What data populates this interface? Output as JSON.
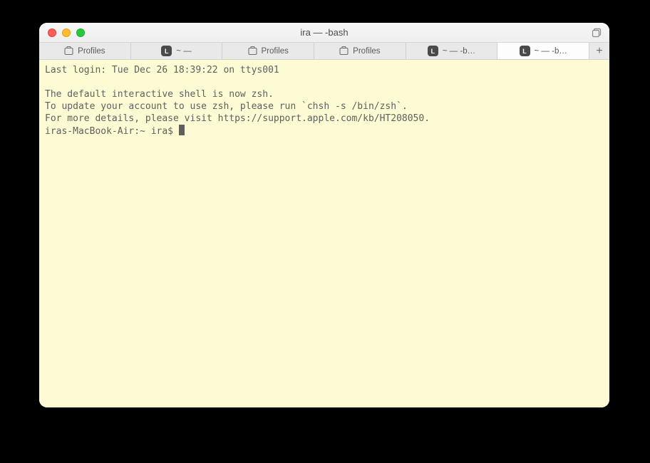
{
  "window": {
    "title": "ira — -bash"
  },
  "tabs": [
    {
      "kind": "profiles",
      "label": "Profiles",
      "active": false
    },
    {
      "kind": "shell",
      "label": "~ —",
      "badge": "L",
      "active": false
    },
    {
      "kind": "profiles",
      "label": "Profiles",
      "active": false
    },
    {
      "kind": "profiles",
      "label": "Profiles",
      "active": false
    },
    {
      "kind": "shell",
      "label": "~ — -b…",
      "badge": "L",
      "active": false
    },
    {
      "kind": "shell",
      "label": "~ — -b…",
      "badge": "L",
      "active": true
    }
  ],
  "newtab_label": "+",
  "terminal": {
    "line1": "Last login: Tue Dec 26 18:39:22 on ttys001",
    "blank": "",
    "line2": "The default interactive shell is now zsh.",
    "line3": "To update your account to use zsh, please run `chsh -s /bin/zsh`.",
    "line4": "For more details, please visit https://support.apple.com/kb/HT208050.",
    "prompt": "iras-MacBook-Air:~ ira$ "
  }
}
